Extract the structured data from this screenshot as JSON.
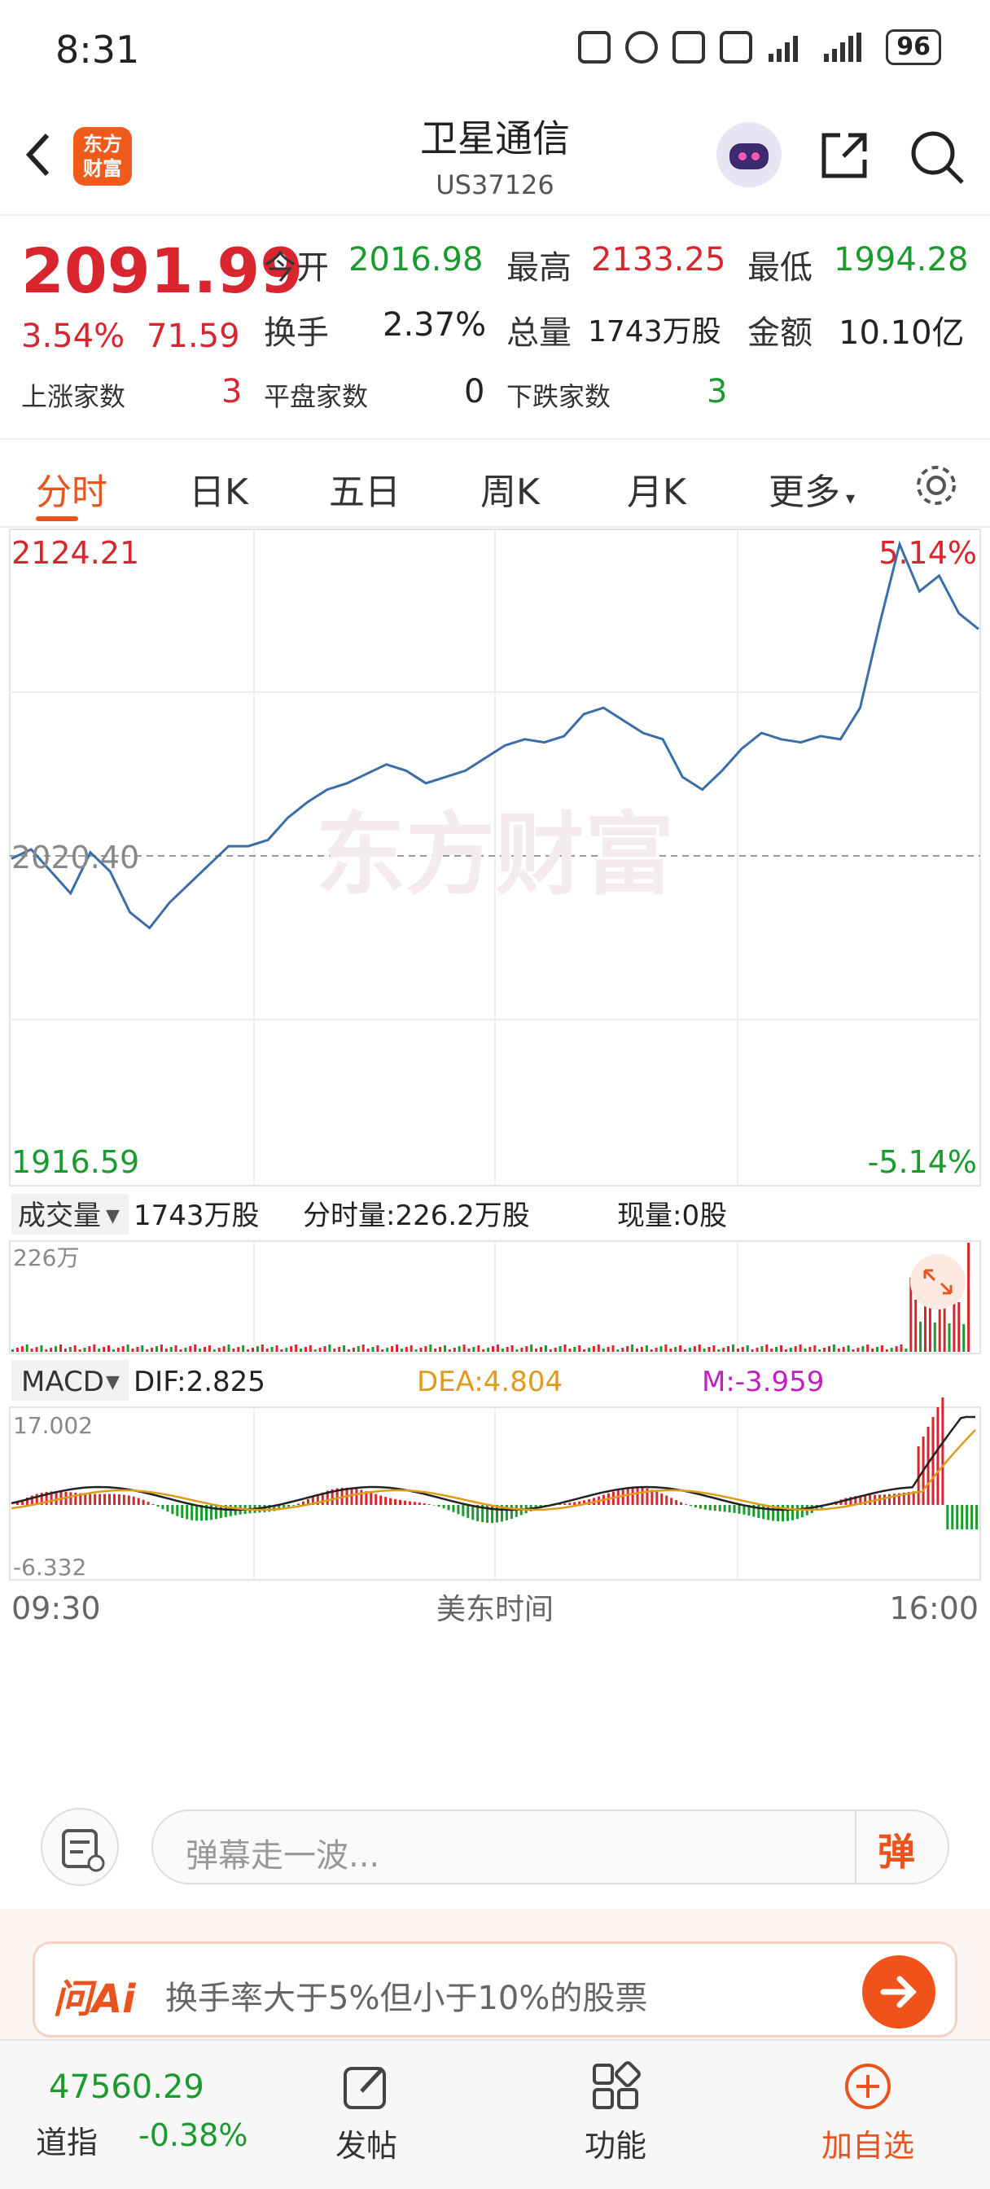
{
  "status_bar": {
    "time": "8:31",
    "battery": "96"
  },
  "header": {
    "title": "卫星通信",
    "code": "US37126",
    "logo_text": "东方财富"
  },
  "quote": {
    "price": "2091.99",
    "change_pct": "3.54%",
    "change": "71.59",
    "open_label": "今开",
    "open": "2016.98",
    "high_label": "最高",
    "high": "2133.25",
    "low_label": "最低",
    "low": "1994.28",
    "turnover_label": "换手",
    "turnover": "2.37%",
    "volume_label": "总量",
    "volume": "1743万股",
    "amount_label": "金额",
    "amount": "10.10亿",
    "up_label": "上涨家数",
    "up": "3",
    "flat_label": "平盘家数",
    "flat": "0",
    "down_label": "下跌家数",
    "down": "3"
  },
  "tabs": [
    "分时",
    "日K",
    "五日",
    "周K",
    "月K",
    "更多"
  ],
  "chart": {
    "price_high": "2124.21",
    "price_prev": "2020.40",
    "price_low": "1916.59",
    "pct_high": "5.14%",
    "pct_low": "-5.14%",
    "watermark": "东方财富",
    "vol_selector": "成交量",
    "vol_total": "1743万股",
    "vol_min": "分时量:226.2万股",
    "vol_now": "现量:0股",
    "vol_max": "226万",
    "macd_selector": "MACD",
    "dif": "DIF:2.825",
    "dea": "DEA:4.804",
    "m": "M:-3.959",
    "macd_max": "17.002",
    "macd_min": "-6.332",
    "time_start": "09:30",
    "time_mid": "美东时间",
    "time_end": "16:00"
  },
  "comment": {
    "placeholder": "弹幕走一波...",
    "danmu_label": "弹"
  },
  "ai": {
    "brand": "问Ai",
    "prompt": "换手率大于5%但小于10%的股票"
  },
  "nav": {
    "index_value": "47560.29",
    "index_name": "道指",
    "index_change": "-0.38%",
    "post": "发帖",
    "func": "功能",
    "add": "加自选"
  },
  "colors": {
    "up": "#d9262e",
    "down": "#1b9a2e",
    "accent": "#e8541c",
    "line": "#3a6ea8"
  },
  "chart_data": {
    "type": "line",
    "title": "",
    "xlabel": "美东时间",
    "x_ticks": [
      "09:30",
      "16:00"
    ],
    "ylim": [
      1916.59,
      2124.21
    ],
    "reference": 2020.4,
    "series": [
      {
        "values": [
          2020,
          2023,
          2016,
          2009,
          2022,
          2016,
          2003,
          1998,
          2006,
          2012,
          2018,
          2024,
          2024,
          2026,
          2033,
          2038,
          2042,
          2044,
          2047,
          2050,
          2048,
          2044,
          2046,
          2048,
          2052,
          2056,
          2058,
          2057,
          2059,
          2066,
          2068,
          2064,
          2060,
          2058,
          2046,
          2042,
          2048,
          2055,
          2060,
          2058,
          2057,
          2059,
          2058,
          2068,
          2095,
          2120,
          2105,
          2110,
          2098,
          2093
        ]
      }
    ]
  }
}
